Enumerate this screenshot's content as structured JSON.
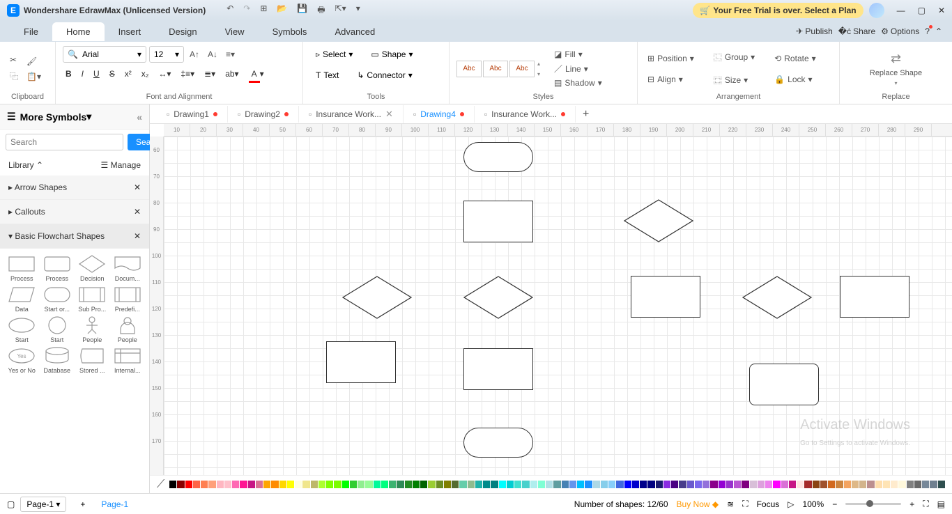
{
  "titlebar": {
    "app_name": "Wondershare EdrawMax (Unlicensed Version)",
    "trial_text": "Your Free Trial is over. Select a Plan"
  },
  "menus": {
    "file": "File",
    "home": "Home",
    "insert": "Insert",
    "design": "Design",
    "view": "View",
    "symbols": "Symbols",
    "advanced": "Advanced",
    "publish": "Publish",
    "share": "Share",
    "options": "Options"
  },
  "ribbon": {
    "clipboard": "Clipboard",
    "font_alignment": "Font and Alignment",
    "font_name": "Arial",
    "font_size": "12",
    "tools": "Tools",
    "select": "Select",
    "shape": "Shape",
    "text": "Text",
    "connector": "Connector",
    "styles": "Styles",
    "style_abc": "Abc",
    "fill": "Fill",
    "line": "Line",
    "shadow": "Shadow",
    "arrangement": "Arrangement",
    "position": "Position",
    "align": "Align",
    "group": "Group",
    "size": "Size",
    "rotate": "Rotate",
    "lock": "Lock",
    "replace": "Replace",
    "replace_shape": "Replace Shape"
  },
  "sidebar": {
    "more_symbols": "More Symbols",
    "search_placeholder": "Search",
    "search_btn": "Search",
    "library": "Library",
    "manage": "Manage",
    "arrow_shapes": "Arrow Shapes",
    "callouts": "Callouts",
    "basic_flowchart": "Basic Flowchart Shapes",
    "shapes": [
      "Process",
      "Process",
      "Decision",
      "Docum...",
      "Data",
      "Start or...",
      "Sub Pro...",
      "Predefi...",
      "Start",
      "Start",
      "People",
      "People",
      "Yes or No",
      "Database",
      "Stored ...",
      "Internal..."
    ]
  },
  "doc_tabs": [
    {
      "name": "Drawing1",
      "modified": true,
      "active": false
    },
    {
      "name": "Drawing2",
      "modified": true,
      "active": false
    },
    {
      "name": "Insurance Work...",
      "modified": false,
      "active": false,
      "closable": true
    },
    {
      "name": "Drawing4",
      "modified": true,
      "active": true
    },
    {
      "name": "Insurance Work...",
      "modified": true,
      "active": false
    }
  ],
  "ruler_h": [
    "10",
    "20",
    "30",
    "40",
    "50",
    "60",
    "70",
    "80",
    "90",
    "100",
    "110",
    "120",
    "130",
    "140",
    "150",
    "160",
    "170",
    "180",
    "190",
    "200",
    "210",
    "220",
    "230",
    "240",
    "250",
    "260",
    "270",
    "280",
    "290"
  ],
  "ruler_v": [
    "60",
    "70",
    "80",
    "90",
    "100",
    "110",
    "120",
    "130",
    "140",
    "150",
    "160",
    "170"
  ],
  "status": {
    "page_select": "Page-1",
    "page_tab": "Page-1",
    "shapes_count": "Number of shapes: 12/60",
    "buy_now": "Buy Now",
    "focus": "Focus",
    "zoom": "100%"
  },
  "watermark": {
    "line1": "Activate Windows",
    "line2": "Go to Settings to activate Windows."
  },
  "colors": [
    "#000000",
    "#8B0000",
    "#FF0000",
    "#FF6347",
    "#FF7F50",
    "#FFA07A",
    "#FFB6C1",
    "#FFC0CB",
    "#FF69B4",
    "#FF1493",
    "#C71585",
    "#DB7093",
    "#FFA500",
    "#FF8C00",
    "#FFD700",
    "#FFFF00",
    "#FFFFE0",
    "#F0E68C",
    "#BDB76B",
    "#ADFF2F",
    "#7FFF00",
    "#7CFC00",
    "#00FF00",
    "#32CD32",
    "#90EE90",
    "#98FB98",
    "#00FA9A",
    "#00FF7F",
    "#3CB371",
    "#2E8B57",
    "#228B22",
    "#008000",
    "#006400",
    "#9ACD32",
    "#6B8E23",
    "#808000",
    "#556B2F",
    "#66CDAA",
    "#8FBC8F",
    "#20B2AA",
    "#008B8B",
    "#008080",
    "#00FFFF",
    "#00CED1",
    "#40E0D0",
    "#48D1CC",
    "#AFEEEE",
    "#7FFFD4",
    "#B0E0E6",
    "#5F9EA0",
    "#4682B4",
    "#6495ED",
    "#00BFFF",
    "#1E90FF",
    "#ADD8E6",
    "#87CEEB",
    "#87CEFA",
    "#4169E1",
    "#0000FF",
    "#0000CD",
    "#00008B",
    "#000080",
    "#191970",
    "#8A2BE2",
    "#4B0082",
    "#483D8B",
    "#6A5ACD",
    "#7B68EE",
    "#9370DB",
    "#8B008B",
    "#9400D3",
    "#9932CC",
    "#BA55D3",
    "#800080",
    "#D8BFD8",
    "#DDA0DD",
    "#EE82EE",
    "#FF00FF",
    "#DA70D6",
    "#C71585",
    "#FFE4E1",
    "#A52A2A",
    "#8B4513",
    "#A0522D",
    "#D2691E",
    "#CD853F",
    "#F4A460",
    "#DEB887",
    "#D2B48C",
    "#BC8F8F",
    "#FFDEAD",
    "#FFE4B5",
    "#FFEBCD",
    "#FFF8DC",
    "#808080",
    "#696969",
    "#778899",
    "#708090",
    "#2F4F4F"
  ]
}
